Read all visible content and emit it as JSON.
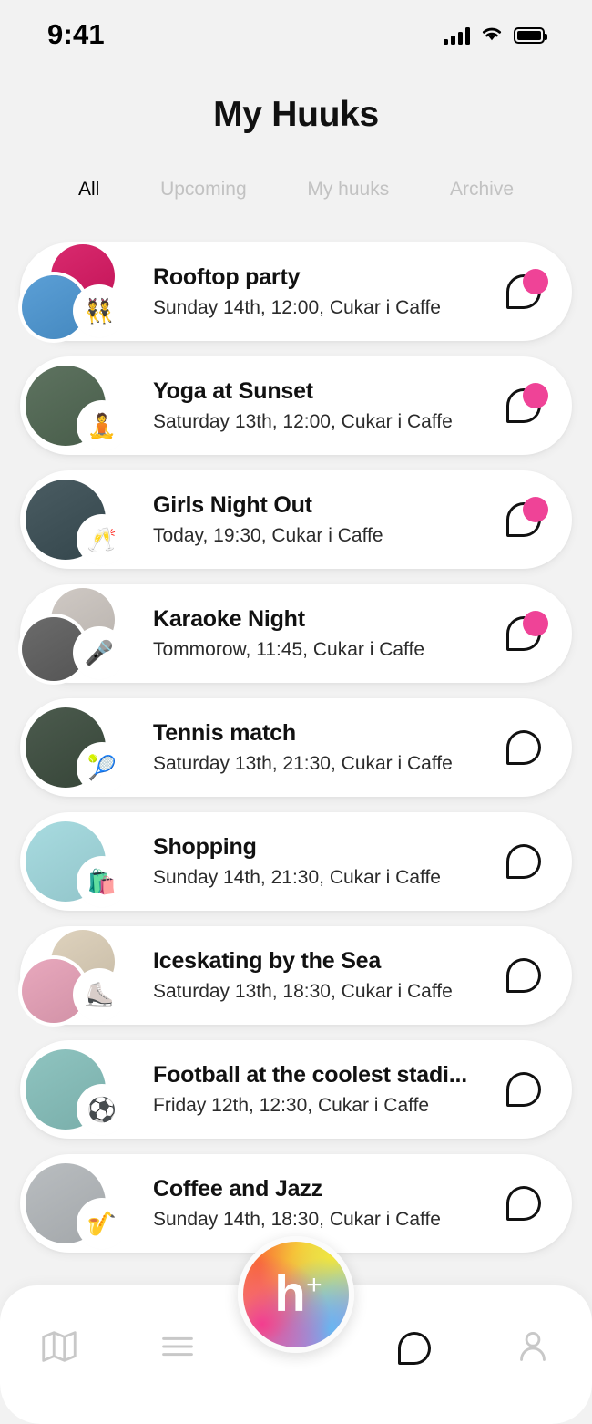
{
  "status_bar": {
    "time": "9:41",
    "signal_icon": "signal-bars-icon",
    "wifi_icon": "wifi-icon",
    "battery_icon": "battery-full-icon"
  },
  "header": {
    "title": "My Huuks"
  },
  "tabs": [
    {
      "label": "All",
      "active": true
    },
    {
      "label": "Upcoming",
      "active": false
    },
    {
      "label": "My huuks",
      "active": false
    },
    {
      "label": "Archive",
      "active": false
    }
  ],
  "colors": {
    "background": "#f2f2f2",
    "card": "#ffffff",
    "badge_pink": "#ef4397",
    "text_primary": "#111111",
    "text_muted": "#c2c2c2",
    "nav_icon_inactive": "#c8c8c8",
    "nav_icon_active": "#111111"
  },
  "huuks": [
    {
      "title": "Rooftop party",
      "subtitle": "Sunday 14th, 12:00, Cukar i Caffe",
      "emoji": "👯",
      "emoji_name": "dancers-emoji",
      "avatar_count": 3,
      "avatar_colors": [
        "#d92a6e",
        "#5b9fd6"
      ],
      "unread": true
    },
    {
      "title": "Yoga at Sunset",
      "subtitle": "Saturday 13th, 12:00, Cukar i Caffe",
      "emoji": "🧘",
      "emoji_name": "yoga-emoji",
      "avatar_count": 1,
      "avatar_colors": [
        "#5e7360"
      ],
      "unread": true
    },
    {
      "title": "Girls Night Out",
      "subtitle": "Today, 19:30, Cukar i Caffe",
      "emoji": "🥂",
      "emoji_name": "champagne-emoji",
      "avatar_count": 1,
      "avatar_colors": [
        "#4a5c62"
      ],
      "unread": true
    },
    {
      "title": "Karaoke Night",
      "subtitle": "Tommorow, 11:45, Cukar i Caffe",
      "emoji": "🎤",
      "emoji_name": "microphone-emoji",
      "avatar_count": 2,
      "avatar_colors": [
        "#cfc9c4",
        "#6b6b6b"
      ],
      "unread": true
    },
    {
      "title": "Tennis match",
      "subtitle": "Saturday 13th, 21:30, Cukar i Caffe",
      "emoji": "🎾",
      "emoji_name": "tennis-ball-emoji",
      "avatar_count": 1,
      "avatar_colors": [
        "#4c5b4e"
      ],
      "unread": false
    },
    {
      "title": "Shopping",
      "subtitle": "Sunday 14th, 21:30, Cukar i Caffe",
      "emoji": "🛍️",
      "emoji_name": "shopping-bags-emoji",
      "avatar_count": 1,
      "avatar_colors": [
        "#a8dbe0"
      ],
      "unread": false
    },
    {
      "title": "Iceskating by the Sea",
      "subtitle": "Saturday 13th, 18:30, Cukar i Caffe",
      "emoji": "⛸️",
      "emoji_name": "ice-skate-emoji",
      "avatar_count": 2,
      "avatar_colors": [
        "#ded2bd",
        "#e8a8bd"
      ],
      "unread": false
    },
    {
      "title": "Football at the coolest stadi...",
      "subtitle": "Friday 12th, 12:30, Cukar i Caffe",
      "emoji": "⚽",
      "emoji_name": "soccer-ball-emoji",
      "avatar_count": 1,
      "avatar_colors": [
        "#8fc4c0"
      ],
      "unread": false
    },
    {
      "title": "Coffee and Jazz",
      "subtitle": "Sunday 14th, 18:30, Cukar i Caffe",
      "emoji": "🎷",
      "emoji_name": "saxophone-emoji",
      "avatar_count": 1,
      "avatar_colors": [
        "#b9bdc0"
      ],
      "unread": false
    }
  ],
  "fab": {
    "label": "h",
    "superscript": "+",
    "name": "create-huuk-button"
  },
  "bottom_nav": [
    {
      "name": "nav-map",
      "icon": "map-icon",
      "active": false
    },
    {
      "name": "nav-list",
      "icon": "hamburger-menu-icon",
      "active": false
    },
    {
      "name": "nav-chat",
      "icon": "chat-bubble-icon",
      "active": true
    },
    {
      "name": "nav-profile",
      "icon": "person-icon",
      "active": false
    }
  ]
}
